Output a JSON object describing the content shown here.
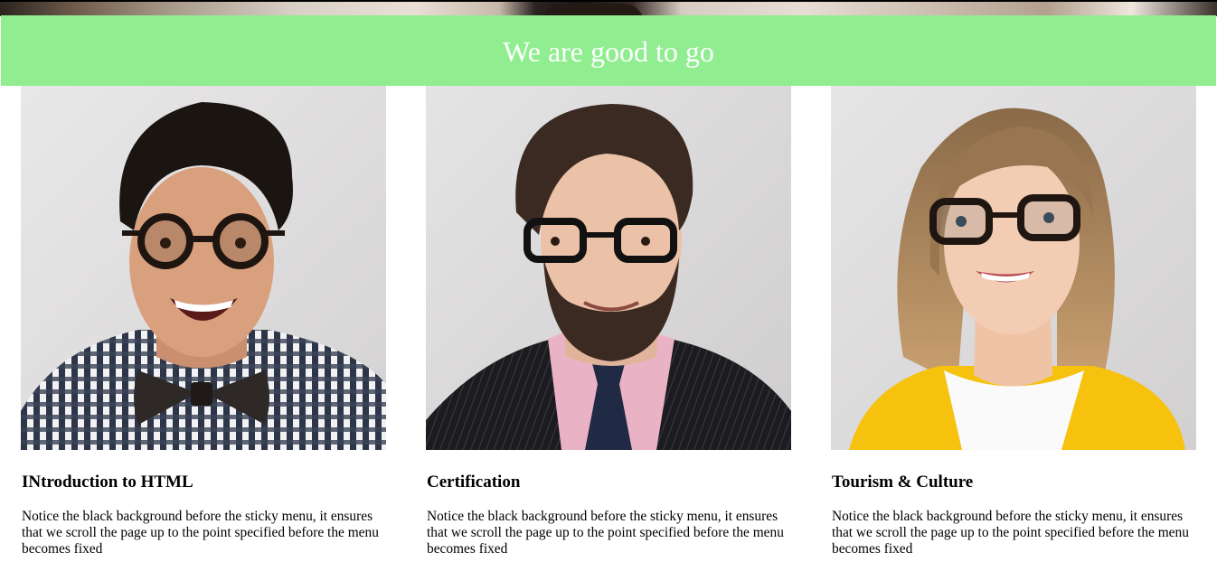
{
  "banner": {
    "title": "We are good to go",
    "background": "#90ee90"
  },
  "cards": [
    {
      "title": "INtroduction to HTML",
      "text": "Notice the black background before the sticky menu, it ensures that we scroll the page up to the point specified before the menu becomes fixed",
      "image": "portrait-man-bowtie"
    },
    {
      "title": "Certification",
      "text": "Notice the black background before the sticky menu, it ensures that we scroll the page up to the point specified before the menu becomes fixed",
      "image": "portrait-man-suit"
    },
    {
      "title": "Tourism & Culture",
      "text": "Notice the black background before the sticky menu, it ensures that we scroll the page up to the point specified before the menu becomes fixed",
      "image": "portrait-woman-yellow"
    }
  ]
}
